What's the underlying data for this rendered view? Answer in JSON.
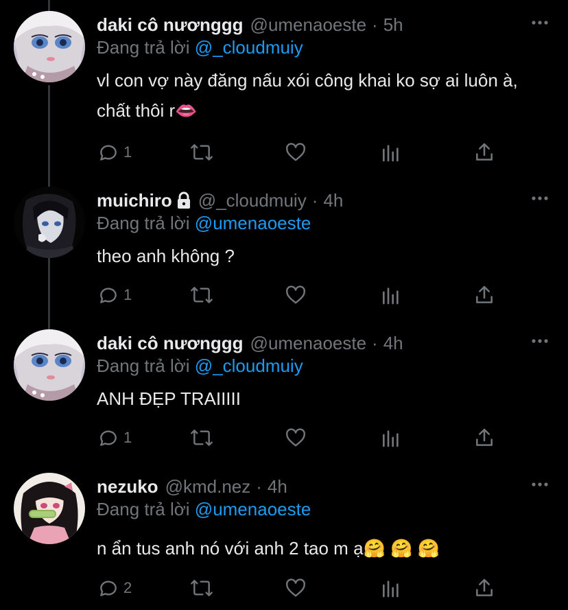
{
  "colors": {
    "background": "#000000",
    "primary_text": "#e7e9ea",
    "secondary_text": "#71767b",
    "link": "#1d9bf0",
    "thread_line": "#333639"
  },
  "tweets": [
    {
      "display_name": "daki cô nươnggg",
      "handle": "@umenaoeste",
      "dot": "·",
      "time": "5h",
      "reply_prefix": "Đang trả lời",
      "reply_to": "@_cloudmuiy",
      "text": "vl con vợ này đăng nấu xói công khai ko sợ ai luôn à, chất thôi r👄",
      "reply_count": "1",
      "protected": false
    },
    {
      "display_name": "muichiro",
      "handle": "@_cloudmuiy",
      "dot": "·",
      "time": "4h",
      "reply_prefix": "Đang trả lời",
      "reply_to": "@umenaoeste",
      "text": "theo anh không ?",
      "reply_count": "1",
      "protected": true
    },
    {
      "display_name": "daki cô nươnggg",
      "handle": "@umenaoeste",
      "dot": "·",
      "time": "4h",
      "reply_prefix": "Đang trả lời",
      "reply_to": "@_cloudmuiy",
      "text": "ANH ĐẸP TRAIIIII",
      "reply_count": "1",
      "protected": false
    },
    {
      "display_name": "nezuko",
      "handle": "@kmd.nez",
      "dot": "·",
      "time": "4h",
      "reply_prefix": "Đang trả lời",
      "reply_to": "@umenaoeste",
      "text": "n ẩn tus anh nó với anh 2 tao m ạ🤗 🤗 🤗",
      "reply_count": "2",
      "protected": false
    }
  ]
}
